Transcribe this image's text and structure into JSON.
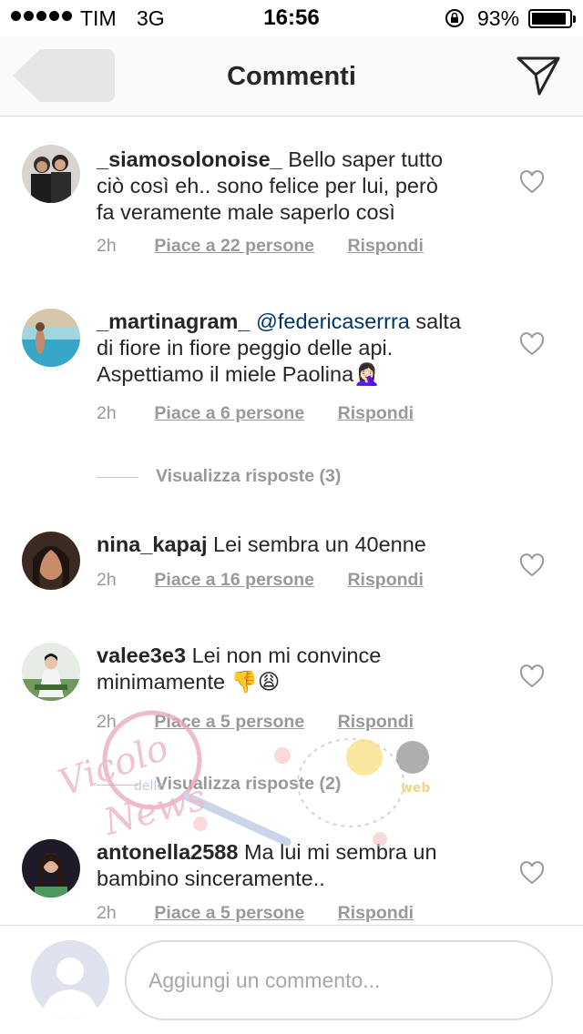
{
  "status_bar": {
    "carrier": "TIM",
    "network": "3G",
    "time": "16:56",
    "battery_percent": "93%",
    "battery_level": 0.93
  },
  "nav": {
    "title": "Commenti",
    "back_icon": "back-arrow-icon",
    "direct_icon": "paper-plane-icon"
  },
  "comments": [
    {
      "username": "_siamosolonoise_",
      "text_lines": [
        "Bello saper tutto",
        "ciò così eh.. sono felice per lui, però",
        "fa veramente male saperlo così"
      ],
      "time": "2h",
      "likes": "Piace a 22 persone",
      "reply": "Rispondi"
    },
    {
      "username": "_martinagram_",
      "mention": "@federicaserrra",
      "text_lines": [
        " salta",
        "di fiore in fiore peggio delle api.",
        "Aspettiamo il miele Paolina🤦🏻‍♀️"
      ],
      "time": "2h",
      "likes": "Piace a 6 persone",
      "reply": "Rispondi"
    },
    {
      "username": "nina_kapaj",
      "text_lines": [
        "Lei sembra un 40enne"
      ],
      "time": "2h",
      "likes": "Piace a 16 persone",
      "reply": "Rispondi"
    },
    {
      "username": "valee3e3",
      "text_lines": [
        "Lei non mi convince",
        "minimamente 👎😩"
      ],
      "time": "2h",
      "likes": "Piace a 5 persone",
      "reply": "Rispondi"
    },
    {
      "username": "antonella2588",
      "text_lines": [
        "Ma lui mi sembra un",
        "bambino sinceramente.."
      ],
      "time": "2h",
      "likes": "Piace a 5 persone",
      "reply": "Rispondi"
    }
  ],
  "view_replies": [
    "Visualizza risposte (3)",
    "Visualizza risposte (2)"
  ],
  "watermark": {
    "line1": "Vicolo",
    "line2": "delle",
    "line3": "News",
    "web": "web"
  },
  "composer": {
    "placeholder": "Aggiungi un commento..."
  },
  "colors": {
    "text": "#262626",
    "meta": "#999999",
    "mention": "#003569",
    "border": "#dbdbdb"
  }
}
